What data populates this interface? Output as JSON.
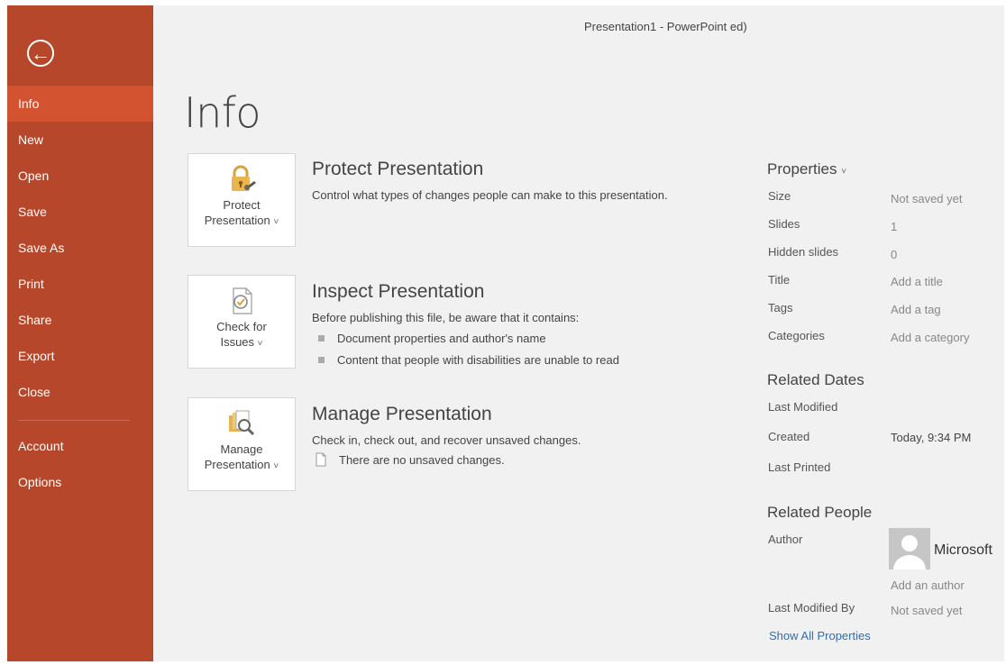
{
  "window": {
    "title": "Presentation1 - PowerPoint ed)"
  },
  "sidebar": {
    "back_icon": "back-arrow-icon",
    "items": [
      {
        "label": "Info"
      },
      {
        "label": "New"
      },
      {
        "label": "Open"
      },
      {
        "label": "Save"
      },
      {
        "label": "Save As"
      },
      {
        "label": "Print"
      },
      {
        "label": "Share"
      },
      {
        "label": "Export"
      },
      {
        "label": "Close"
      },
      {
        "label": "Account"
      },
      {
        "label": "Options"
      }
    ],
    "active": "Info",
    "color": "#b7472a",
    "active_color": "#d35230"
  },
  "main": {
    "title": "Info",
    "protect": {
      "tile_line1": "Protect",
      "tile_line2": "Presentation",
      "dropdown": "˅",
      "icon": "lock-key-icon",
      "heading": "Protect Presentation",
      "desc": "Control what types of changes people can make to this presentation."
    },
    "inspect": {
      "tile_line1": "Check for",
      "tile_line2": "Issues",
      "dropdown": "˅",
      "icon": "inspect-document-icon",
      "heading": "Inspect Presentation",
      "desc": "Before publishing this file, be aware that it contains:",
      "bullets": [
        "Document properties and author's name",
        "Content that people with disabilities are unable to read"
      ]
    },
    "manage": {
      "tile_line1": "Manage",
      "tile_line2": "Presentation",
      "dropdown": "˅",
      "icon": "manage-versions-icon",
      "heading": "Manage Presentation",
      "desc": "Check in, check out, and recover unsaved changes.",
      "note": "There are no unsaved changes.",
      "note_icon": "document-icon"
    }
  },
  "properties": {
    "heading": "Properties",
    "dropdown": "˅",
    "rows": [
      {
        "label": "Size",
        "value": "Not saved yet"
      },
      {
        "label": "Slides",
        "value": "1"
      },
      {
        "label": "Hidden slides",
        "value": "0"
      },
      {
        "label": "Title",
        "value": "Add a title"
      },
      {
        "label": "Tags",
        "value": "Add a tag"
      },
      {
        "label": "Categories",
        "value": "Add a category"
      }
    ],
    "related_dates": {
      "heading": "Related Dates",
      "rows": [
        {
          "label": "Last Modified",
          "value": ""
        },
        {
          "label": "Created",
          "value": "Today, 9:34 PM"
        },
        {
          "label": "Last Printed",
          "value": ""
        }
      ]
    },
    "related_people": {
      "heading": "Related People",
      "author_label": "Author",
      "author_name": "Microsoft",
      "avatar_icon": "person-avatar-icon",
      "add_author": "Add an author",
      "last_modified_by_label": "Last Modified By",
      "last_modified_by_value": "Not saved yet"
    },
    "show_all": "Show All Properties"
  }
}
